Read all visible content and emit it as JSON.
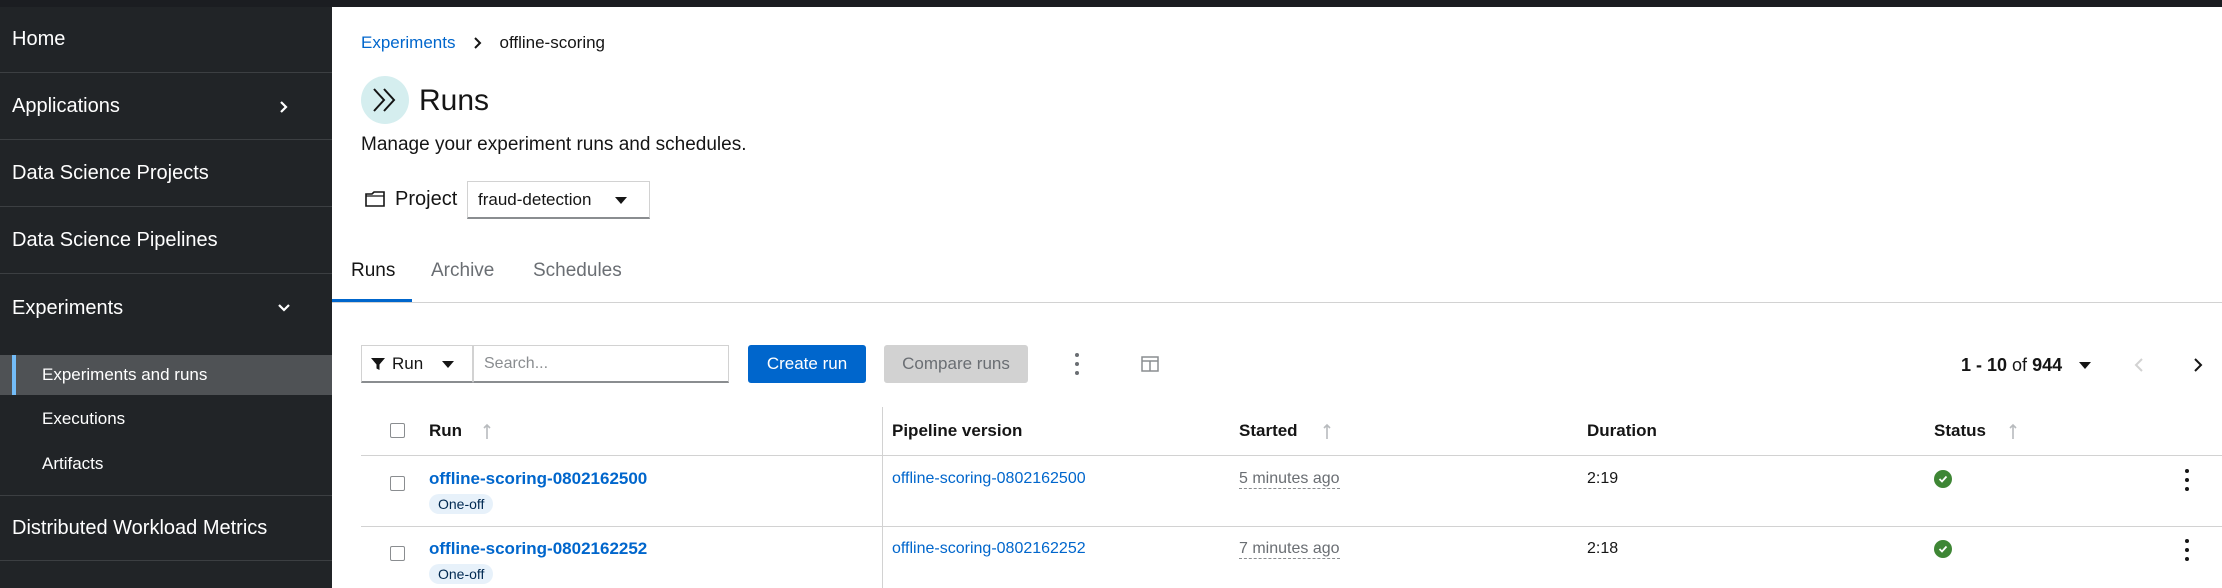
{
  "sidebar": {
    "items": [
      {
        "label": "Home"
      },
      {
        "label": "Applications"
      },
      {
        "label": "Data Science Projects"
      },
      {
        "label": "Data Science Pipelines"
      },
      {
        "label": "Experiments"
      },
      {
        "label": "Distributed Workload Metrics"
      }
    ],
    "experiments_sub": [
      {
        "label": "Experiments and runs",
        "active": true
      },
      {
        "label": "Executions"
      },
      {
        "label": "Artifacts"
      }
    ]
  },
  "breadcrumb": {
    "parent": "Experiments",
    "current": "offline-scoring"
  },
  "page": {
    "title": "Runs",
    "description": "Manage your experiment runs and schedules.",
    "project_label": "Project",
    "project_value": "fraud-detection"
  },
  "tabs": [
    {
      "label": "Runs",
      "active": true
    },
    {
      "label": "Archive"
    },
    {
      "label": "Schedules"
    }
  ],
  "toolbar": {
    "filter_label": "Run",
    "search_placeholder": "Search...",
    "create_label": "Create run",
    "compare_label": "Compare runs"
  },
  "pagination": {
    "range": "1 - 10",
    "of": "of",
    "total": "944"
  },
  "table": {
    "headers": {
      "run": "Run",
      "pipeline_version": "Pipeline version",
      "started": "Started",
      "duration": "Duration",
      "status": "Status"
    },
    "rows": [
      {
        "run": "offline-scoring-0802162500",
        "label": "One-off",
        "pipeline_version": "offline-scoring-0802162500",
        "started": "5 minutes ago",
        "duration": "2:19",
        "status": "success"
      },
      {
        "run": "offline-scoring-0802162252",
        "label": "One-off",
        "pipeline_version": "offline-scoring-0802162252",
        "started": "7 minutes ago",
        "duration": "2:18",
        "status": "success"
      }
    ]
  },
  "colors": {
    "accent": "#0066cc",
    "sidebar_bg": "#212427",
    "success": "#3e8635"
  }
}
